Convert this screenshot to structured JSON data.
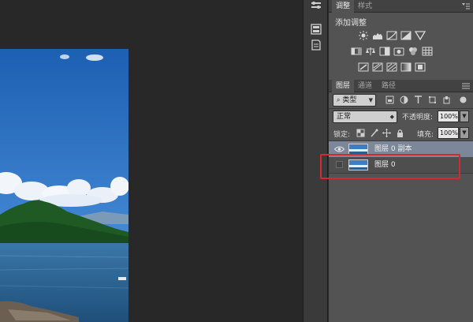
{
  "adjustments_panel": {
    "tabs": [
      "调整",
      "样式"
    ],
    "active_tab": "调整",
    "title": "添加调整",
    "icons_row1": [
      "brightness-icon",
      "levels-icon",
      "curves-icon",
      "exposure-icon",
      "vibrance-icon"
    ],
    "icons_row2": [
      "hue-saturation-icon",
      "color-balance-icon",
      "black-white-icon",
      "photo-filter-icon",
      "channel-mixer-icon",
      "color-lookup-icon"
    ],
    "icons_row3": [
      "invert-icon",
      "posterize-icon",
      "threshold-icon",
      "gradient-map-icon",
      "selective-color-icon"
    ]
  },
  "layers_panel": {
    "tabs": [
      "图层",
      "通道",
      "路径"
    ],
    "active_tab": "图层",
    "filter_kind": "类型",
    "blend_mode": "正常",
    "opacity_label": "不透明度:",
    "opacity_value": "100%",
    "lock_label": "锁定:",
    "fill_label": "填充:",
    "fill_value": "100%",
    "layers": [
      {
        "name": "图层 0 副本",
        "visible": true,
        "selected": true
      },
      {
        "name": "图层 0",
        "visible": false,
        "selected": false
      }
    ]
  },
  "colors": {
    "highlight": "#d42a2a",
    "selected_row": "#7c8799",
    "panel_bg": "#535353"
  }
}
